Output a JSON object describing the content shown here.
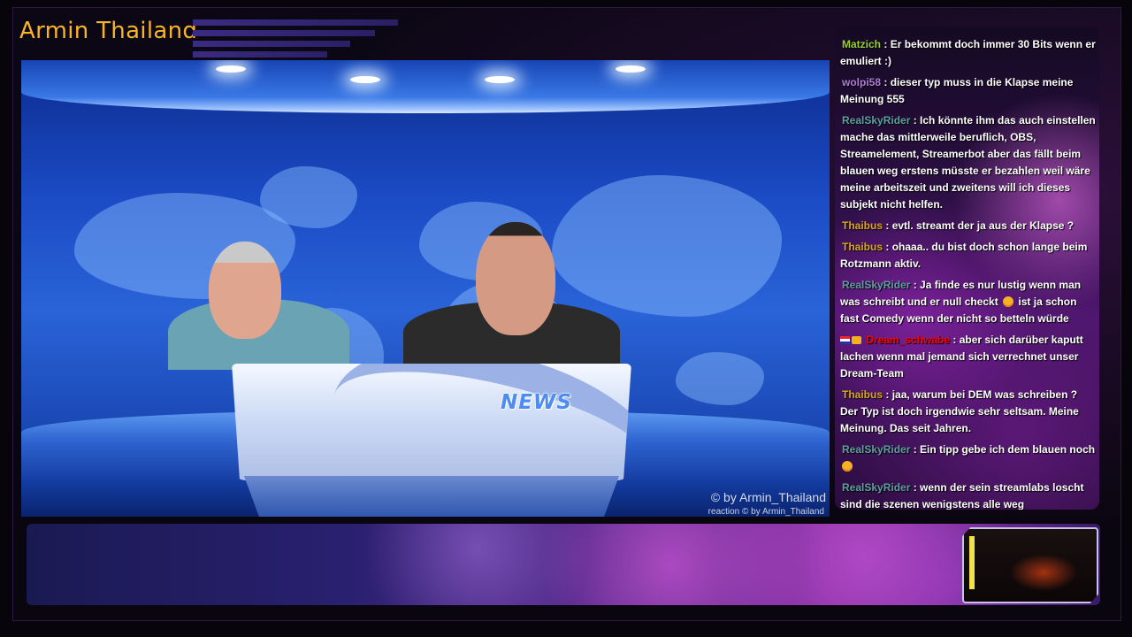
{
  "stream": {
    "title": "Armin Thailand",
    "news_label": "NEWS",
    "watermark": "© by Armin_Thailand",
    "watermark_small": "reaction  © by Armin_Thailand"
  },
  "colors": {
    "title": "#f7b428",
    "studio_blue": "#1b4bc5",
    "chat_purple": "#4a166a",
    "username_green": "#9acd32",
    "username_blue": "#5f9ea0",
    "username_orange": "#daa520",
    "username_red": "#ff0000"
  },
  "chat": {
    "messages": [
      {
        "user": "Matzich",
        "user_color": "#9acd32",
        "text": ": Er bekommt doch immer 30 Bits wenn er emuliert :)"
      },
      {
        "user": "wolpi58",
        "user_color": "#b07ad6",
        "text": ": dieser typ muss in die Klapse meine Meinung 555"
      },
      {
        "user": "RealSkyRider",
        "user_color": "#5f9ea0",
        "text": ": Ich könnte ihm das auch einstellen mache das mittlerweile beruflich, OBS, Streamelement, Streamerbot aber das fällt beim blauen weg erstens müsste er bezahlen weil wäre meine arbeitszeit und zweitens will ich dieses subjekt nicht helfen."
      },
      {
        "user": "Thaibus",
        "user_color": "#daa520",
        "text": ": evtl. streamt der ja aus der Klapse ?"
      },
      {
        "user": "Thaibus",
        "user_color": "#daa520",
        "text": ": ohaaa.. du bist doch schon lange beim Rotzmann aktiv."
      },
      {
        "user": "RealSkyRider",
        "user_color": "#5f9ea0",
        "text": ": Ja finde es nur lustig wenn man was schreibt und er null checkt",
        "emote": "grinning-emoji",
        "text_after": " ist ja schon fast Comedy wenn der nicht so betteln würde"
      },
      {
        "user": "Dream_schwabe",
        "user_color": "#ff0000",
        "badges": true,
        "text": ": aber sich darüber kaputt lachen wenn mal jemand sich verrechnet unser Dream-Team"
      },
      {
        "user": "Thaibus",
        "user_color": "#daa520",
        "text": ": jaa, warum bei DEM was schreiben ? Der Typ ist doch irgendwie sehr seltsam. Meine Meinung. Das seit Jahren."
      },
      {
        "user": "RealSkyRider",
        "user_color": "#5f9ea0",
        "text": ": Ein tipp gebe ich dem blauen noch",
        "emote": "grinning-emoji",
        "text_after": ""
      },
      {
        "user": "RealSkyRider",
        "user_color": "#5f9ea0",
        "text": ": wenn der sein streamlabs loscht sind die szenen wenigstens alle weg"
      }
    ]
  }
}
